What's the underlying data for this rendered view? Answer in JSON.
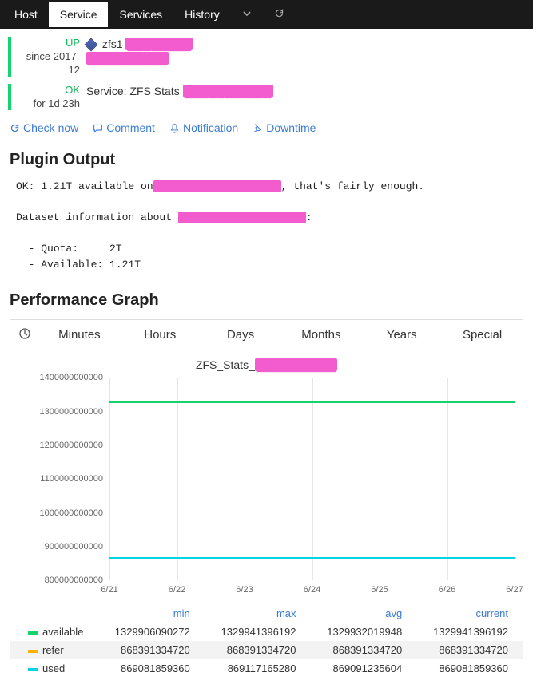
{
  "nav": {
    "tabs": [
      "Host",
      "Service",
      "Services",
      "History"
    ],
    "active": "Service"
  },
  "status": {
    "host": {
      "state": "UP",
      "since": "since 2017-12",
      "label": "zfs1",
      "redact1": "████████",
      "redact2": "██████████"
    },
    "service": {
      "state": "OK",
      "dur": "for 1d 23h",
      "prefix": "Service: ZFS Stats",
      "redact": "███████████"
    }
  },
  "actions": {
    "check": "Check now",
    "comment": "Comment",
    "notify": "Notification",
    "downtime": "Downtime"
  },
  "plugin": {
    "heading": "Plugin Output",
    "l1a": "OK: 1.21T available on",
    "l1r": "████████████████████",
    "l1b": ", that's fairly enough.",
    "l2a": "Dataset information about ",
    "l2r": "████████████████████",
    "l3": "  - Quota:     2T",
    "l4": "  - Available: 1.21T"
  },
  "graph": {
    "heading": "Performance Graph",
    "ranges": [
      "Minutes",
      "Hours",
      "Days",
      "Months",
      "Years",
      "Special"
    ],
    "active_range": "Days",
    "title_prefix": "ZFS_Stats_",
    "title_redact": "██████████"
  },
  "chart_data": {
    "type": "line",
    "title": "ZFS_Stats",
    "xlabel": "",
    "ylabel": "",
    "ylim": [
      800000000000,
      1400000000000
    ],
    "yticks": [
      800000000000,
      900000000000,
      1000000000000,
      1100000000000,
      1200000000000,
      1300000000000,
      1400000000000
    ],
    "categories": [
      "6/21",
      "6/22",
      "6/23",
      "6/24",
      "6/25",
      "6/26",
      "6/27"
    ],
    "series": [
      {
        "name": "available",
        "color": "#13d36b",
        "values": [
          1329906090272,
          1329941396192,
          1329941396192,
          1329941396192,
          1329932019948,
          1329941396192,
          1329941396192
        ]
      },
      {
        "name": "refer",
        "color": "#ffb000",
        "values": [
          868391334720,
          868391334720,
          868391334720,
          868391334720,
          868391334720,
          868391334720,
          868391334720
        ]
      },
      {
        "name": "used",
        "color": "#00d4e6",
        "values": [
          869081859360,
          869117165280,
          869117165280,
          869091235604,
          869091235604,
          869081859360,
          869081859360
        ]
      }
    ],
    "stats": {
      "headers": [
        "min",
        "max",
        "avg",
        "current"
      ],
      "rows": [
        {
          "name": "available",
          "swatch": "sw-av",
          "vals": [
            "1329906090272",
            "1329941396192",
            "1329932019948",
            "1329941396192"
          ]
        },
        {
          "name": "refer",
          "swatch": "sw-rf",
          "vals": [
            "868391334720",
            "868391334720",
            "868391334720",
            "868391334720"
          ]
        },
        {
          "name": "used",
          "swatch": "sw-us",
          "vals": [
            "869081859360",
            "869117165280",
            "869091235604",
            "869081859360"
          ]
        }
      ]
    }
  }
}
